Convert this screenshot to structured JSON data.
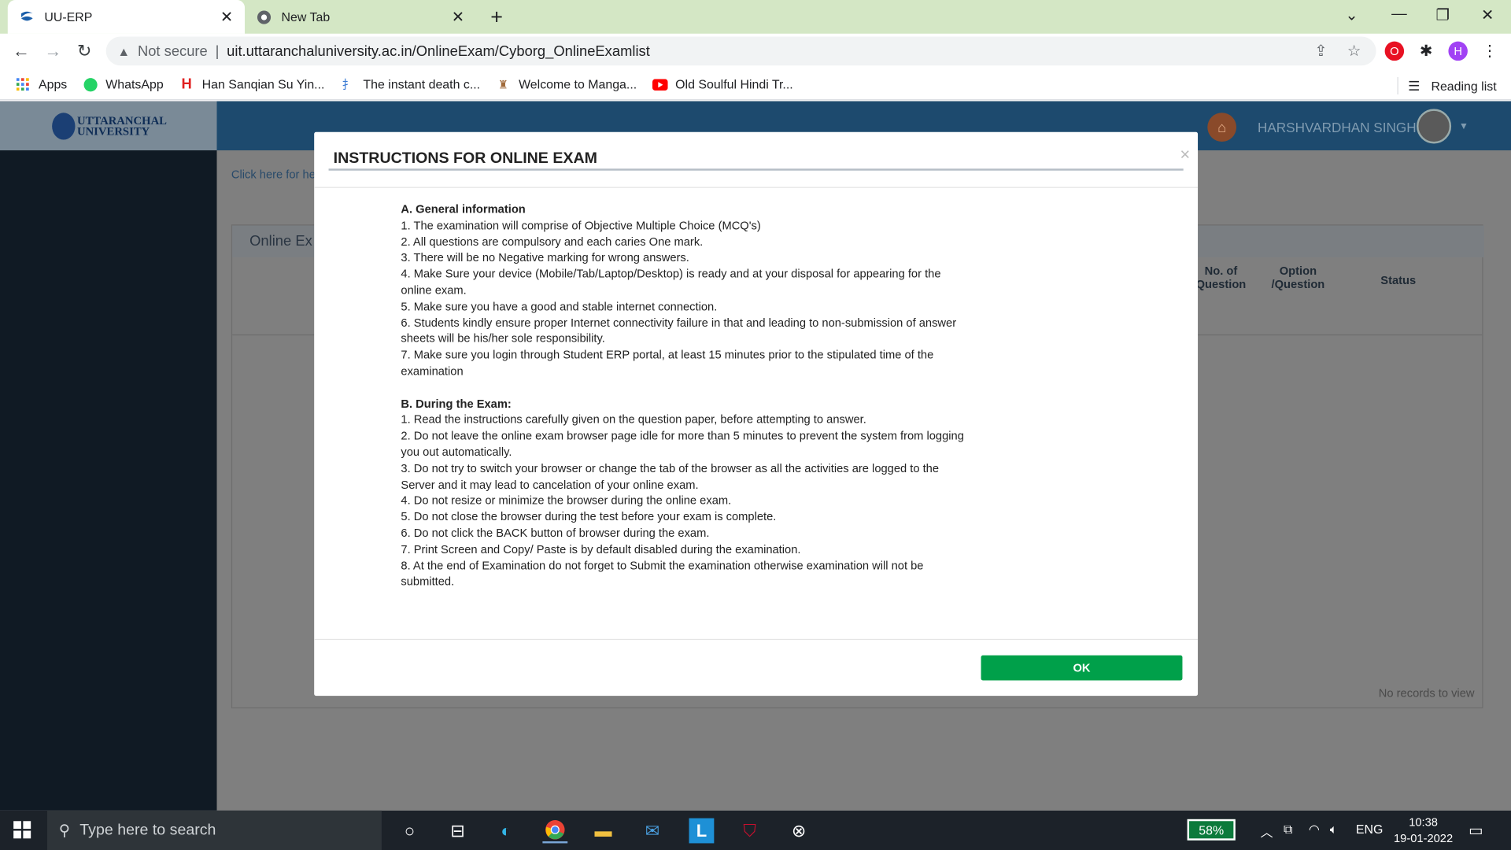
{
  "browser": {
    "tabs": [
      {
        "title": "UU-ERP",
        "active": true,
        "icon": "uu-erp-favicon"
      },
      {
        "title": "New Tab",
        "active": false,
        "icon": "chrome-icon"
      }
    ],
    "new_tab_label": "+",
    "security": "Not secure",
    "url": "uit.uttaranchaluniversity.ac.in/OnlineExam/Cyborg_OnlineExamlist",
    "profile_initial": "H",
    "bookmarks": [
      {
        "label": "Apps",
        "icon": "apps-grid-icon"
      },
      {
        "label": "WhatsApp",
        "icon": "whatsapp-icon"
      },
      {
        "label": "Han Sanqian Su Yin...",
        "icon": "h-icon"
      },
      {
        "label": "The instant death c...",
        "icon": "manga-icon"
      },
      {
        "label": "Welcome to Manga...",
        "icon": "manga-site-icon"
      },
      {
        "label": "Old Soulful Hindi Tr...",
        "icon": "youtube-icon"
      }
    ],
    "reading_list": "Reading list"
  },
  "app": {
    "logo_line1": "UTTARANCHAL",
    "logo_line2": "UNIVERSITY",
    "user_name": "HARSHVARDHAN SINGH",
    "help_link": "Click here for he",
    "panel_title": "Online Ex",
    "columns": [
      "No. of Question",
      "Option /Question",
      "Status"
    ],
    "no_records": "No records to view"
  },
  "modal": {
    "title": "INSTRUCTIONS FOR ONLINE EXAM",
    "close": "×",
    "section_a": "A. General information",
    "items_a": [
      "1. The examination will comprise of Objective Multiple Choice (MCQ's)",
      "2. All questions are compulsory and each caries One mark.",
      "3. There will be no Negative marking for wrong answers.",
      "4. Make Sure your device (Mobile/Tab/Laptop/Desktop) is ready and at your disposal for appearing for the online exam.",
      "5. Make sure you have a good and stable internet connection.",
      "6. Students kindly ensure proper Internet connectivity failure in that and leading to non-submission of answer sheets will be his/her sole responsibility.",
      "7. Make sure you login through Student ERP portal, at least 15 minutes prior to the stipulated time of the examination"
    ],
    "section_b": "B. During the Exam:",
    "items_b": [
      "1. Read the instructions carefully given on the question paper, before attempting to answer.",
      "2. Do not leave the online exam browser page idle for more than 5 minutes to prevent the system from logging you out automatically.",
      "3. Do not try to switch your browser or change the tab of the browser as all the activities are logged to the Server and it may lead to cancelation of your online exam.",
      "4. Do not resize or minimize the browser during the online exam.",
      "5. Do not close the browser during the test before your exam is complete.",
      "6. Do not click the BACK button of browser during the exam.",
      "7. Print Screen and Copy/ Paste is by default disabled during the examination.",
      "8. At the end of Examination do not forget to Submit the examination otherwise examination will not be submitted."
    ],
    "ok_label": "OK"
  },
  "taskbar": {
    "search_placeholder": "Type here to search",
    "battery": "58%",
    "language": "ENG",
    "time": "10:38",
    "date": "19-01-2022"
  }
}
